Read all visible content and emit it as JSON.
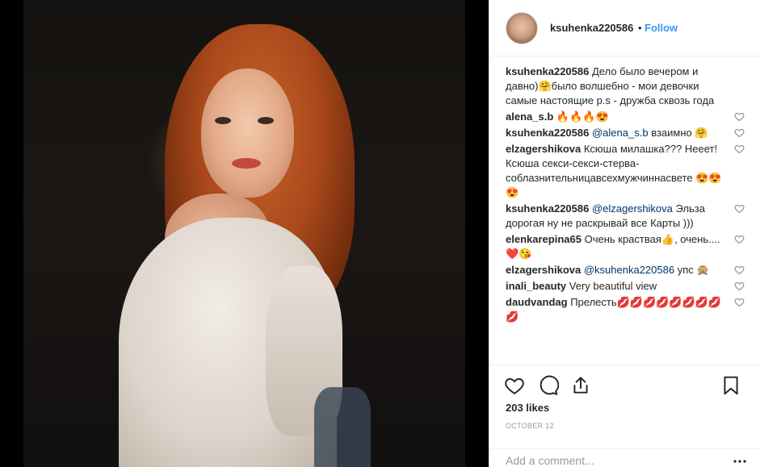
{
  "post": {
    "username": "ksuhenka220586",
    "separator": "•",
    "follow_label": "Follow",
    "likes_text": "203 likes",
    "date_text": "OCTOBER 12",
    "add_comment_placeholder": "Add a comment..."
  },
  "comments": [
    {
      "user": "ksuhenka220586",
      "text": "Дело было вечером и давно)🤗было волшебно - мои девочки самые настоящие p.s - дружба сквозь года",
      "has_like": false
    },
    {
      "user": "alena_s.b",
      "text": "🔥🔥🔥😍",
      "has_like": true
    },
    {
      "user": "ksuhenka220586",
      "mention": "@alena_s.b",
      "text": "взаимно 🤗",
      "has_like": true
    },
    {
      "user": "elzagershikova",
      "text": "Ксюша милашка??? Нееет! Ксюша секси-секси-стерва-соблазнительницавсехмужчиннасвете 😍😍😍",
      "has_like": true
    },
    {
      "user": "ksuhenka220586",
      "mention": "@elzagershikova",
      "text": "Эльза дорогая ну не раскрывай все Карты )))",
      "has_like": true
    },
    {
      "user": "elenkarepina65",
      "text": "Очень краствая👍, очень....❤️😘",
      "has_like": true
    },
    {
      "user": "elzagershikova",
      "mention": "@ksuhenka220586",
      "text": "упс 🙊",
      "has_like": true
    },
    {
      "user": "inali_beauty",
      "text": "Very beautiful view",
      "has_like": true
    },
    {
      "user": "daudvandag",
      "text": "Прелесть💋💋💋💋💋💋💋💋💋",
      "has_like": true
    }
  ],
  "icons": {
    "like": "heart-outline-icon",
    "comment": "speech-bubble-icon",
    "share": "share-icon",
    "save": "bookmark-icon",
    "more": "more-options-icon"
  },
  "colors": {
    "link_blue": "#3897f0",
    "mention_blue": "#003569",
    "text": "#262626",
    "muted": "#999999",
    "border": "#efefef"
  }
}
